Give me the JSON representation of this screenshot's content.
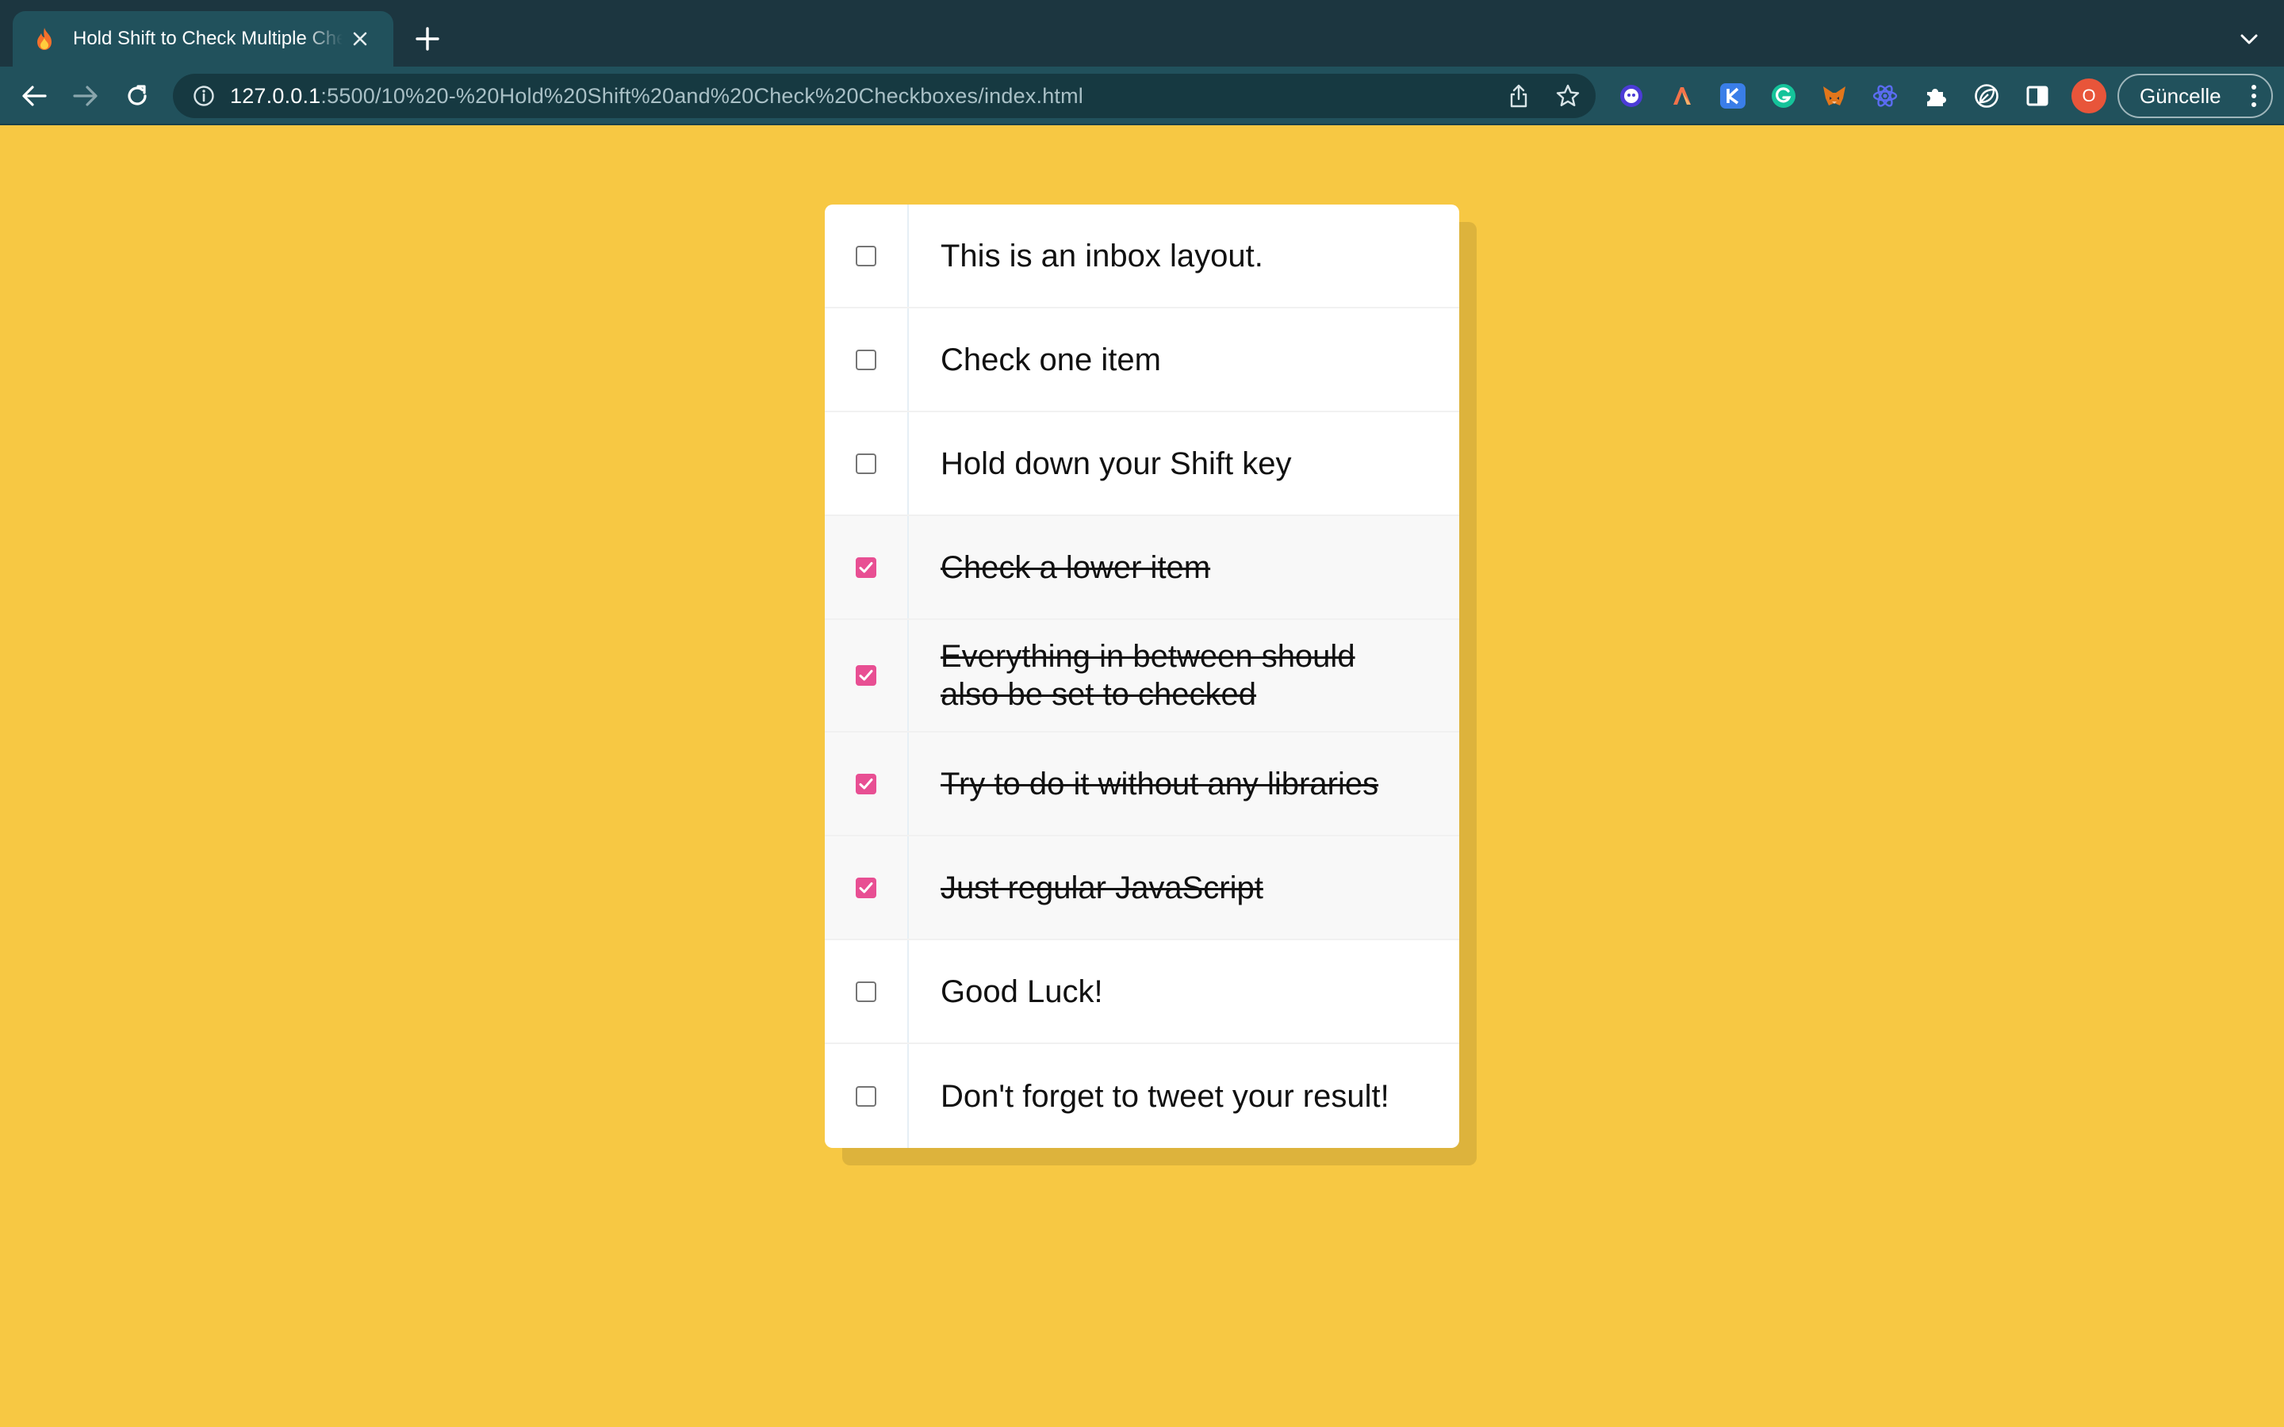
{
  "browser": {
    "tab_title": "Hold Shift to Check Multiple Checkboxes",
    "url_host": "127.0.0.1",
    "url_rest": ":5500/10%20-%20Hold%20Shift%20and%20Check%20Checkboxes/index.html",
    "profile_initial": "O",
    "update_label": "Güncelle",
    "extensions": [
      "ghost-extension",
      "angular-extension",
      "k-extension",
      "grammarly-extension",
      "metamask-extension",
      "react-extension",
      "puzzle-extension",
      "leaf-extension",
      "sidebar-extension"
    ],
    "icons": {
      "favicon": "fire-icon",
      "back": "arrow-left-icon",
      "forward": "arrow-right-icon",
      "reload": "reload-icon",
      "info": "info-icon",
      "share": "share-icon",
      "bookmark": "star-icon",
      "tab_search": "chevron-down-icon"
    }
  },
  "colors": {
    "page_background": "#f7c843",
    "checkbox_checked": "#e84f93",
    "chrome_tabbar": "#1c3640",
    "chrome_toolbar": "#21515c"
  },
  "inbox": {
    "items": [
      {
        "label": "This is an inbox layout.",
        "checked": false
      },
      {
        "label": "Check one item",
        "checked": false
      },
      {
        "label": "Hold down your Shift key",
        "checked": false
      },
      {
        "label": "Check a lower item",
        "checked": true
      },
      {
        "label": "Everything in between should also be set to checked",
        "checked": true
      },
      {
        "label": "Try to do it without any libraries",
        "checked": true
      },
      {
        "label": "Just regular JavaScript",
        "checked": true
      },
      {
        "label": "Good Luck!",
        "checked": false
      },
      {
        "label": "Don't forget to tweet your result!",
        "checked": false
      }
    ]
  }
}
